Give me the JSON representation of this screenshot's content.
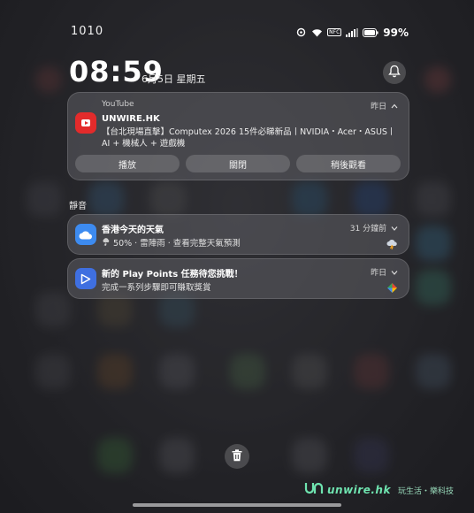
{
  "status_bar": {
    "time": "1010",
    "network_badge": "NFC",
    "battery_percent": "99%",
    "icons": [
      "ring-icon",
      "wifi-icon",
      "nfc-icon",
      "signal-icon",
      "battery-icon"
    ]
  },
  "lock_clock": {
    "time": "08:59",
    "date": "6月5日 星期五"
  },
  "notifications": [
    {
      "app": "YouTube",
      "title": "UNWIRE.HK",
      "body": "【台北現場直擊】Computex 2026 15件必睇新品丨NVIDIA・Acer・ASUS丨AI + 機械人 + 遊戲機",
      "when": "昨日",
      "actions": [
        "播放",
        "關閉",
        "稍後觀看"
      ],
      "icon": "youtube-icon",
      "accent": "#e32b2b"
    }
  ],
  "silent_section": {
    "label": "靜音",
    "items": [
      {
        "title": "香港今天的天氣",
        "body": "50% · 雷陣雨 · 查看完整天氣預測",
        "when": "31 分鐘前",
        "icon": "weather-cloud-icon",
        "accent": "#3d8bf0"
      },
      {
        "title": "新的 Play Points 任務待您挑戰！",
        "body": "完成一系列步驟即可賺取獎賞",
        "when": "昨日",
        "icon": "play-store-icon",
        "accent": "#3f6fe0"
      }
    ]
  },
  "watermark": {
    "brand": "unwire.hk",
    "tagline": "玩生活・樂科技"
  },
  "bottom": {
    "clear_icon": "trash-icon"
  }
}
